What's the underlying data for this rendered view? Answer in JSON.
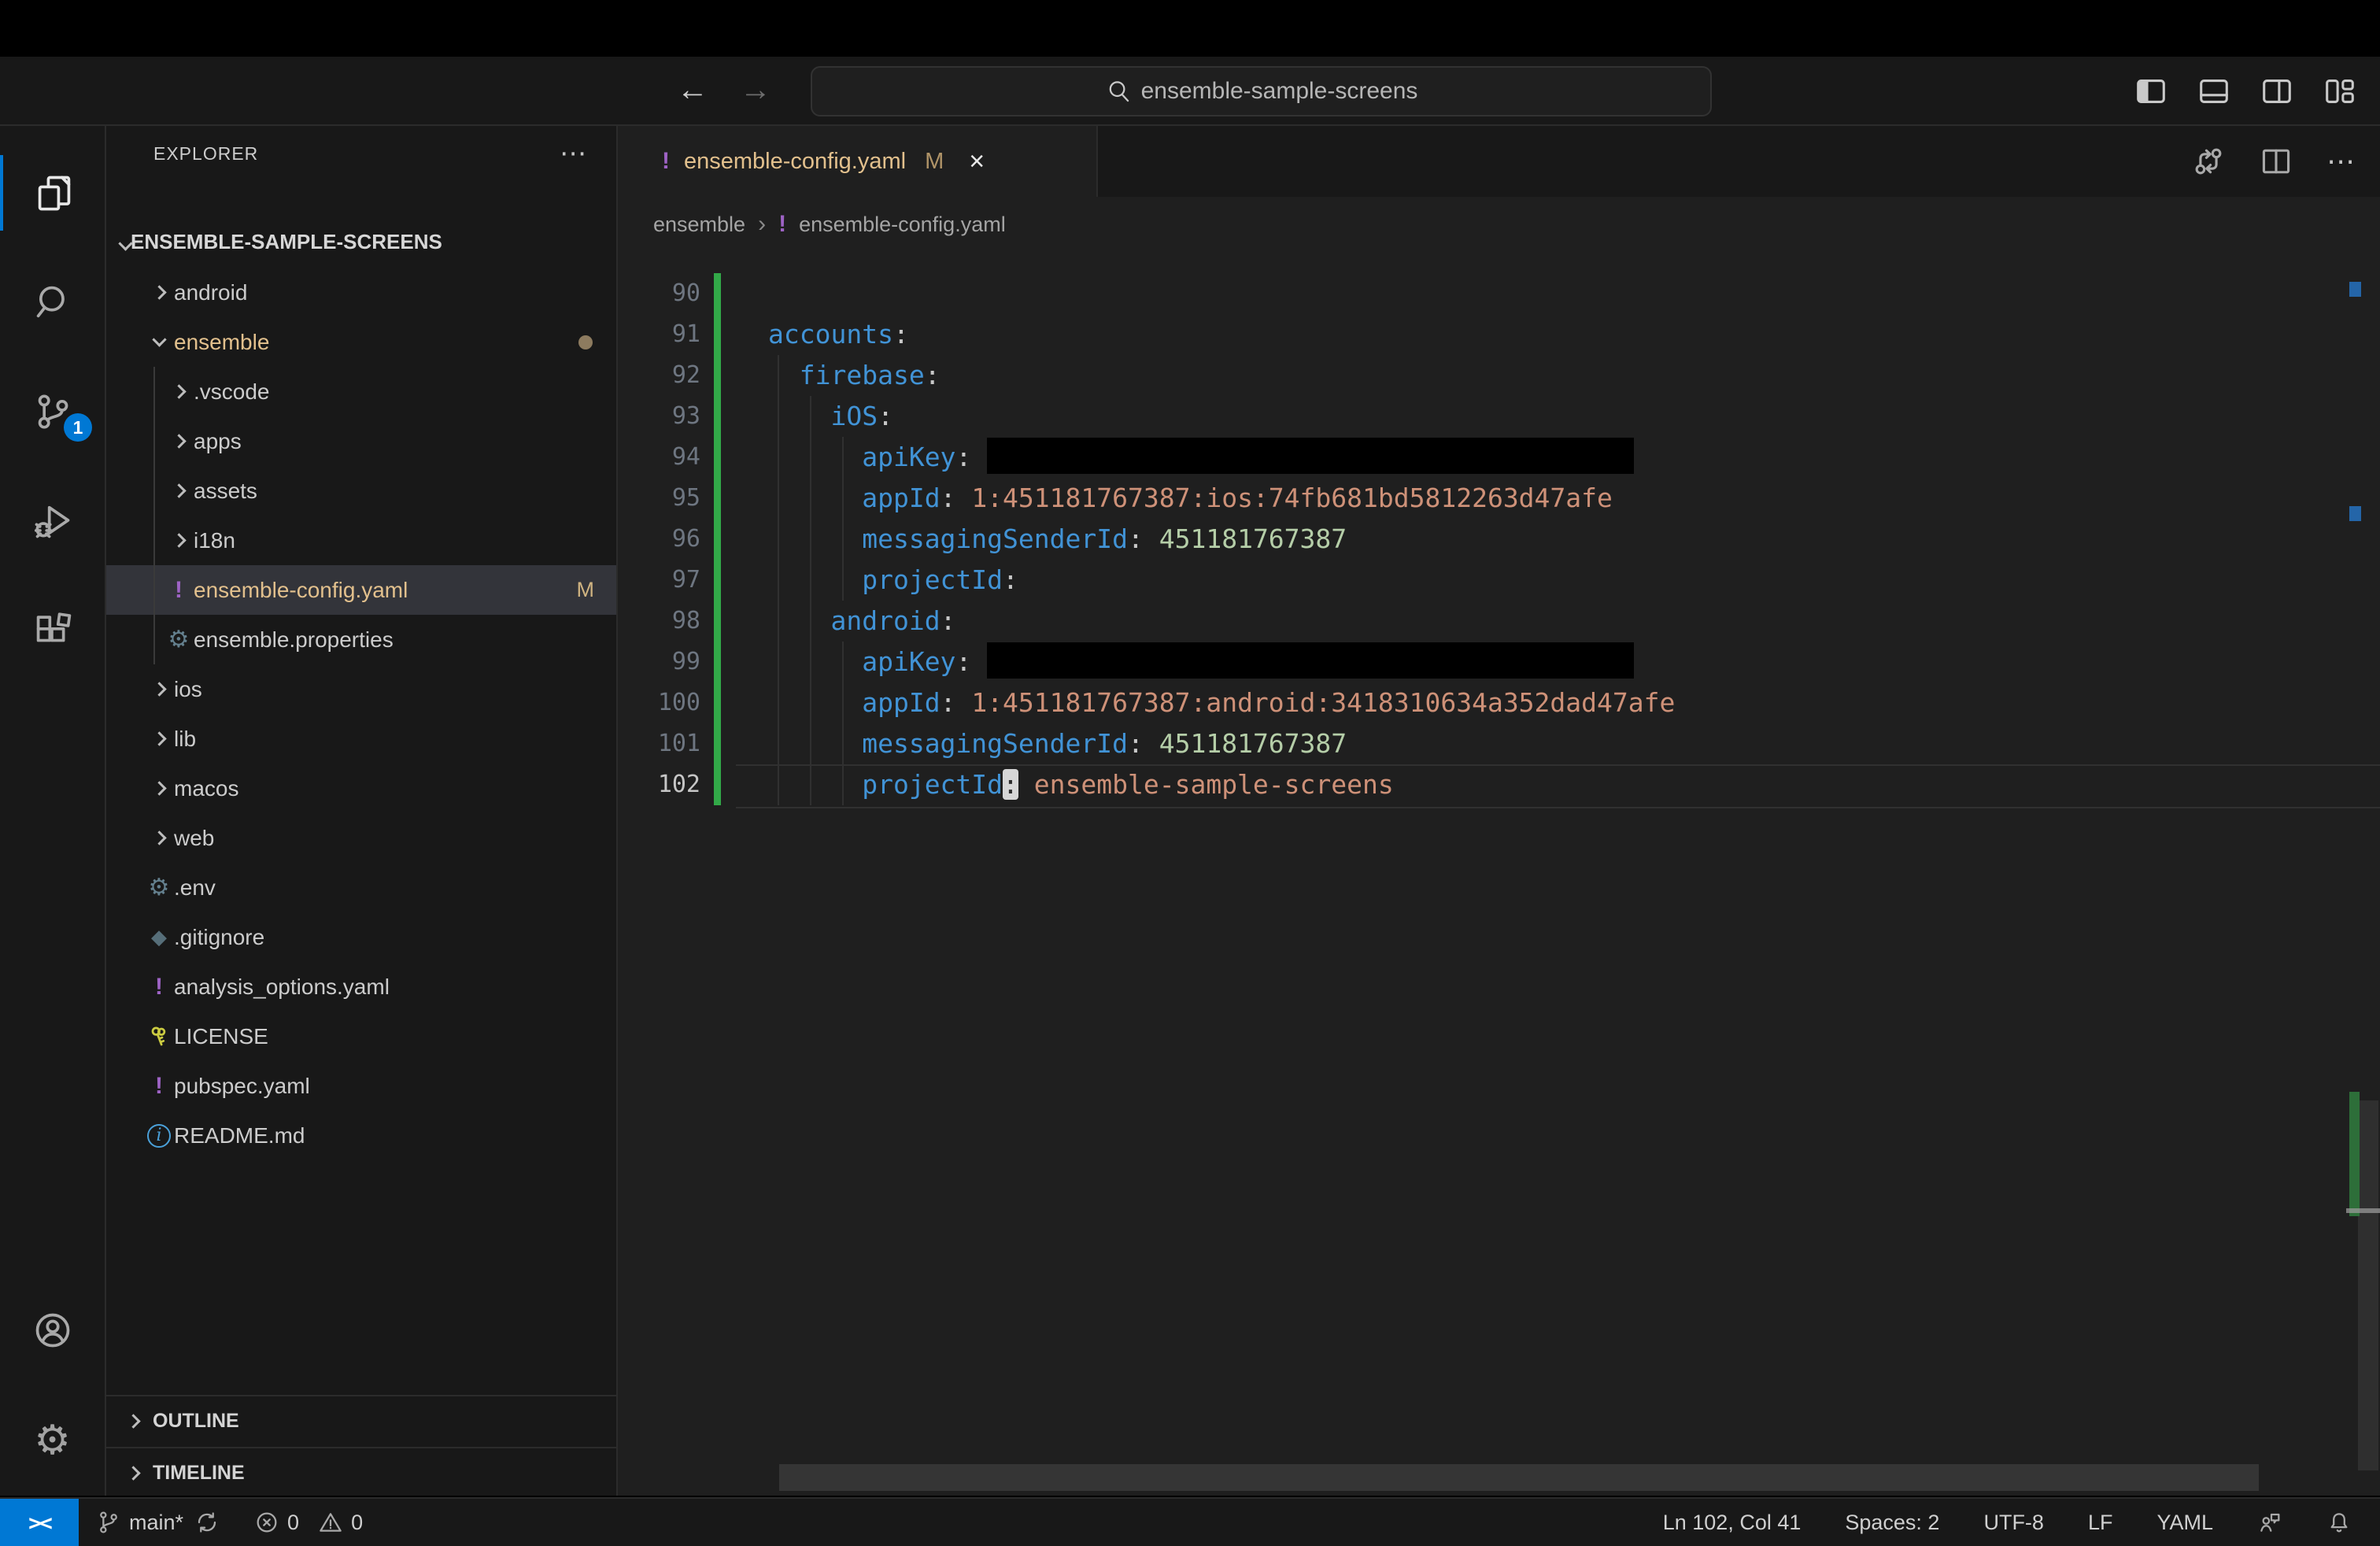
{
  "icons_text": {
    "more": "⋯",
    "close": "×",
    "breadcrumb_sep": "›",
    "remote": "><",
    "yaml_glyph": "!",
    "git_glyph": "◆",
    "gear_glyph": "⚙",
    "info_glyph": "i",
    "back_arrow": "←",
    "forward_arrow": "→"
  },
  "colors": {
    "accent": "#0078d4",
    "git_modified": "#E2C08D",
    "yaml_icon_purple": "#9E63C5",
    "modified_gutter_green": "#32a948",
    "key_blue": "#4193d6",
    "string_orange": "#CE9178",
    "number_green": "#B5CEA8"
  },
  "titlebar": {
    "search_value": "ensemble-sample-screens"
  },
  "activity_bar": {
    "scm_badge": "1"
  },
  "sidebar": {
    "header": "EXPLORER",
    "root_label": "ENSEMBLE-SAMPLE-SCREENS",
    "items": [
      {
        "label": "android",
        "type": "folder",
        "level": 1,
        "expanded": false
      },
      {
        "label": "ensemble",
        "type": "folder",
        "level": 1,
        "expanded": true,
        "modified": true,
        "dot": true
      },
      {
        "label": ".vscode",
        "type": "folder",
        "level": 2,
        "expanded": false
      },
      {
        "label": "apps",
        "type": "folder",
        "level": 2,
        "expanded": false
      },
      {
        "label": "assets",
        "type": "folder",
        "level": 2,
        "expanded": false
      },
      {
        "label": "i18n",
        "type": "folder",
        "level": 2,
        "expanded": false
      },
      {
        "label": "ensemble-config.yaml",
        "type": "file",
        "icon": "yaml-icon",
        "level": 2,
        "selected": true,
        "modified": true,
        "badge": "M"
      },
      {
        "label": "ensemble.properties",
        "type": "file",
        "icon": "gear-icon",
        "level": 2
      },
      {
        "label": "ios",
        "type": "folder",
        "level": 1,
        "expanded": false
      },
      {
        "label": "lib",
        "type": "folder",
        "level": 1,
        "expanded": false
      },
      {
        "label": "macos",
        "type": "folder",
        "level": 1,
        "expanded": false
      },
      {
        "label": "web",
        "type": "folder",
        "level": 1,
        "expanded": false
      },
      {
        "label": ".env",
        "type": "file",
        "icon": "gear-icon",
        "level": 1
      },
      {
        "label": ".gitignore",
        "type": "file",
        "icon": "git-icon",
        "level": 1
      },
      {
        "label": "analysis_options.yaml",
        "type": "file",
        "icon": "yaml-icon",
        "level": 1
      },
      {
        "label": "LICENSE",
        "type": "file",
        "icon": "key-icon",
        "level": 1
      },
      {
        "label": "pubspec.yaml",
        "type": "file",
        "icon": "yaml-icon",
        "level": 1
      },
      {
        "label": "README.md",
        "type": "file",
        "icon": "info-icon",
        "level": 1
      }
    ],
    "panels": [
      {
        "label": "OUTLINE"
      },
      {
        "label": "TIMELINE"
      }
    ]
  },
  "editor": {
    "tab": {
      "label": "ensemble-config.yaml",
      "badge": "M",
      "close": "×"
    },
    "breadcrumbs": {
      "0": "ensemble",
      "1": "ensemble-config.yaml"
    },
    "code": {
      "language": "yaml",
      "lines": [
        {
          "n": 90,
          "indent": 0,
          "key": null
        },
        {
          "n": 91,
          "indent": 0,
          "key": "accounts"
        },
        {
          "n": 92,
          "indent": 2,
          "key": "firebase"
        },
        {
          "n": 93,
          "indent": 4,
          "key": "iOS"
        },
        {
          "n": 94,
          "indent": 6,
          "key": "apiKey",
          "redacted": true
        },
        {
          "n": 95,
          "indent": 6,
          "key": "appId",
          "value": "1:451181767387:ios:74fb681bd5812263d47afe",
          "vtype": "str"
        },
        {
          "n": 96,
          "indent": 6,
          "key": "messagingSenderId",
          "value": "451181767387",
          "vtype": "num"
        },
        {
          "n": 97,
          "indent": 6,
          "key": "projectId"
        },
        {
          "n": 98,
          "indent": 4,
          "key": "android"
        },
        {
          "n": 99,
          "indent": 6,
          "key": "apiKey",
          "redacted": true
        },
        {
          "n": 100,
          "indent": 6,
          "key": "appId",
          "value": "1:451181767387:android:3418310634a352dad47afe",
          "vtype": "str"
        },
        {
          "n": 101,
          "indent": 6,
          "key": "messagingSenderId",
          "value": "451181767387",
          "vtype": "num"
        },
        {
          "n": 102,
          "indent": 6,
          "key": "projectId",
          "value": "ensemble-sample-screens",
          "vtype": "str",
          "current": true,
          "colon_hl": true
        }
      ]
    }
  },
  "status_bar": {
    "branch": "main*",
    "errors": "0",
    "warnings": "0",
    "ln_col": "Ln 102, Col 41",
    "spaces": "Spaces: 2",
    "encoding": "UTF-8",
    "eol": "LF",
    "language": "YAML"
  }
}
